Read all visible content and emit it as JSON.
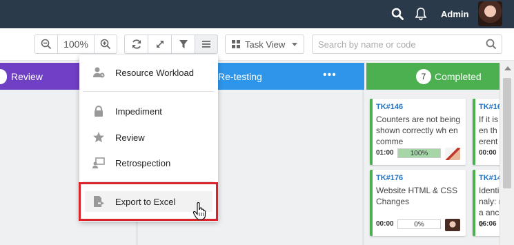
{
  "header": {
    "user_name": "Admin",
    "icons": [
      "search-icon",
      "bell-icon"
    ]
  },
  "toolbar": {
    "zoom_level": "100%",
    "view_label": "Task View",
    "search_placeholder": "Search by name or code"
  },
  "columns": [
    {
      "title": "Review",
      "color": "#6f3fc4"
    },
    {
      "title": "Re-testing",
      "color": "#2d96ea",
      "menu": "•••"
    },
    {
      "title": "Completed",
      "count": "7",
      "color": "#4caf50"
    }
  ],
  "cards": [
    {
      "code": "TK#146",
      "desc": "Counters are not being shown correctly wh en comme",
      "time": "01:00",
      "progress": "100%",
      "progress_value": 1.0
    },
    {
      "code": "TK#176",
      "desc": "Website HTML & CSS Changes",
      "time": "00:00",
      "progress": "0%",
      "progress_value": 0.0
    },
    {
      "code": "TK#16",
      "desc": "If it is hen th ferent",
      "time": "00:00"
    },
    {
      "code": "TK#14",
      "desc": "Identi analy: na ancoe",
      "time": "06:06"
    }
  ],
  "dropdown": {
    "items": [
      {
        "label": "Resource Workload",
        "icon": "resource-workload-icon"
      },
      {
        "label": "Impediment",
        "icon": "lock-icon"
      },
      {
        "label": "Review",
        "icon": "star-icon"
      },
      {
        "label": "Retrospection",
        "icon": "retrospection-icon"
      },
      {
        "label": "Export to Excel",
        "icon": "export-excel-icon"
      }
    ]
  },
  "colors": {
    "topbar": "#2b3a4a",
    "highlight": "#d9232a",
    "accent_blue": "#1f73c4"
  }
}
